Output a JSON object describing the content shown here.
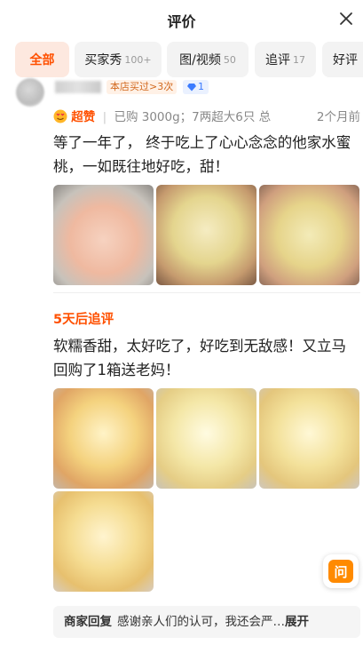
{
  "header": {
    "title": "评价"
  },
  "tabs": [
    {
      "label": "全部",
      "count": ""
    },
    {
      "label": "买家秀",
      "count": "100+"
    },
    {
      "label": "图/视频",
      "count": "50"
    },
    {
      "label": "追评",
      "count": "17"
    },
    {
      "label": "好评",
      "count": ""
    }
  ],
  "review": {
    "buy_badge": "本店买过>3次",
    "vip_level": "1",
    "rating_label": "超赞",
    "purchase_spec": "已购 3000g；7两超大6只 总",
    "time": "2个月前",
    "text": "等了一年了， 终于吃上了心心念念的他家水蜜桃，一如既往地好吃，甜！",
    "followup_title": "5天后追评",
    "followup_text": "软糯香甜，太好吃了，好吃到无敌感！又立马回购了1箱送老妈！"
  },
  "ask_button": {
    "label": "问"
  },
  "merchant_reply": {
    "label": "商家回复",
    "text": "感谢亲人们的认可，我还会严…",
    "expand": "展开"
  },
  "colors": {
    "accent": "#ff5000",
    "tab_bg": "#f3f3f3",
    "active_tab_bg": "#fde8df"
  }
}
